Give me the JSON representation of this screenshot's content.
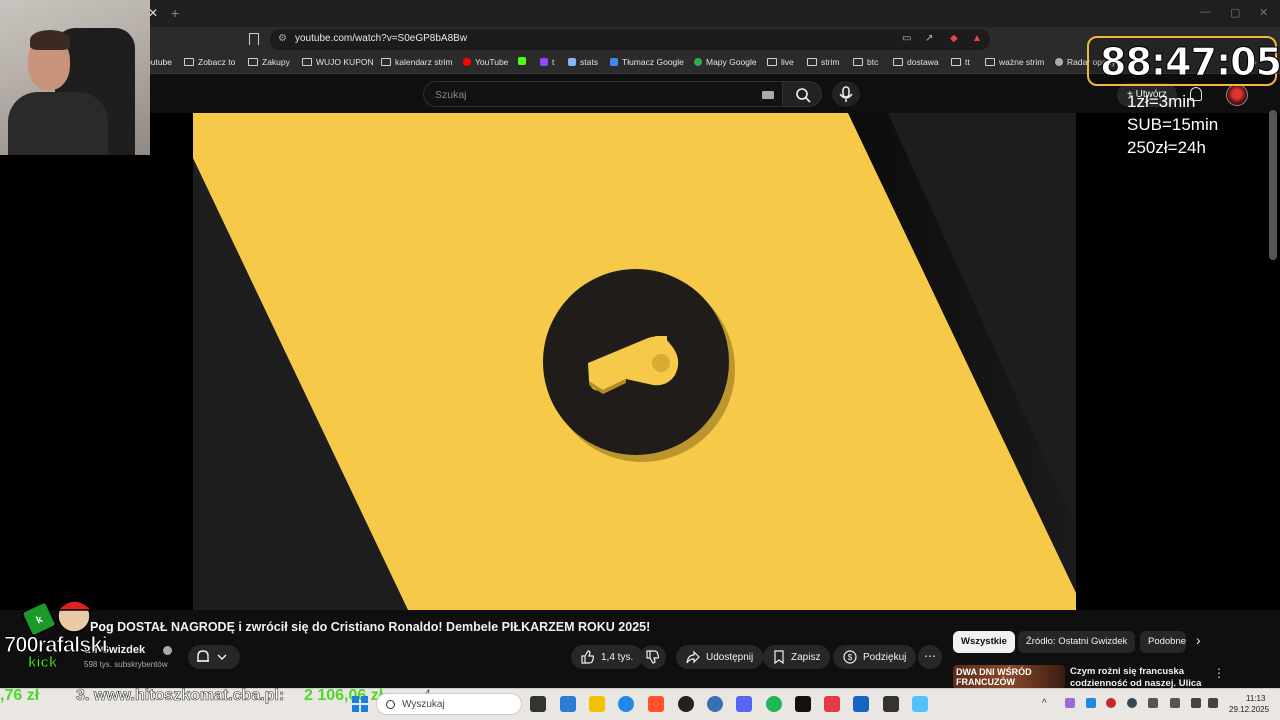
{
  "browser": {
    "url": "youtube.com/watch?v=S0eGP8bA8Bw",
    "bookmarks": [
      "outube",
      "Zobacz to",
      "Zakupy",
      "WUJO KUPON",
      "kalendarz strim",
      "YouTube",
      "t",
      "stats",
      "Tłumacz Google",
      "Mapy Google",
      "live",
      "strim",
      "btc",
      "dostawa",
      "tt",
      "ważne strim",
      "Radar opady"
    ]
  },
  "youtube": {
    "search_placeholder": "Szukaj",
    "create_label": "Utwórz",
    "video": {
      "title": "DOSTAŁ NAGRODĘ i zwrócił się do Cristiano Ronaldo! Dembele PIŁKARZEM ROKU 2025!",
      "title_prefix_fragment": "Pog",
      "channel": "tni Gwizdek",
      "subscribers": "598 tys. subskrybentów",
      "likes": "1,4 tys.",
      "share_label": "Udostępnij",
      "save_label": "Zapisz",
      "thanks_label": "Podziękuj",
      "more_label": "⋯"
    },
    "chips": [
      "Wszystkie",
      "Źródło: Ostatni Gwizdek",
      "Podobne"
    ],
    "recommendation": {
      "thumb_text": "DWA DNI WŚRÓD FRANCUZÓW",
      "title": "Czym rożni się francuska codzienność od naszej. Ulica"
    }
  },
  "overlay": {
    "timer": "88:47:05",
    "rules": [
      "1zł=3min",
      "SUB=15min",
      "250zł=24h"
    ],
    "streamer_name": "700rafalski",
    "platform": "kick",
    "ticker": {
      "left_amount": ",76 zł",
      "entry": "3. www.hitoszkomat.cba.pl:",
      "entry_amount": "2 106,06 zł",
      "suffix": "4"
    }
  },
  "taskbar": {
    "search_placeholder": "Wyszukaj",
    "time": "11:13",
    "date": "29.12.2025"
  },
  "colors": {
    "video_yellow": "#f7c948",
    "video_dark": "#1d1d1d",
    "timer_border": "#f5b640",
    "ticker_green": "#4dd82a",
    "kick_green": "#53fc18"
  }
}
